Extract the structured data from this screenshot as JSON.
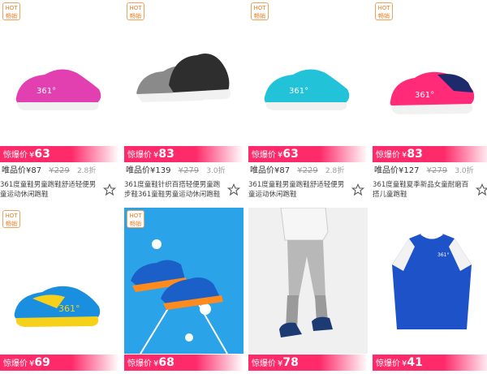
{
  "badge": {
    "line1": "HOT",
    "line2": "畅销"
  },
  "price_label": "惊爆价",
  "currency": "¥",
  "vip_label": "唯品价",
  "products": [
    {
      "price": "63",
      "vip_price": "87",
      "orig_price": "229",
      "discount": "2.8折",
      "title": "361度童鞋男童跑鞋舒适轻便男童运动休闲跑鞋",
      "image": "pink-sneaker",
      "bg": "#ffffff",
      "color": "#e23fb0"
    },
    {
      "price": "83",
      "vip_price": "139",
      "orig_price": "279",
      "discount": "3.0折",
      "title": "361度童鞋针织百搭轻便男童跑步鞋361童鞋男童运动休闲跑鞋",
      "image": "grey-knit-sneaker",
      "bg": "#ffffff",
      "color": "#8a8a8a"
    },
    {
      "price": "63",
      "vip_price": "87",
      "orig_price": "229",
      "discount": "2.8折",
      "title": "361度童鞋男童跑鞋舒适轻便男童运动休闲跑鞋",
      "image": "cyan-sneaker",
      "bg": "#ffffff",
      "color": "#22c2d8"
    },
    {
      "price": "83",
      "vip_price": "127",
      "orig_price": "279",
      "discount": "3.0折",
      "title": "361度童鞋夏季新品女童耐磨百搭儿童跑鞋",
      "image": "pink-navy-sneaker",
      "bg": "#ffffff",
      "color": "#ff2a78"
    },
    {
      "price": "69",
      "title": "",
      "image": "blue-yellow-sneaker",
      "bg": "#ffffff",
      "color": "#1a8fe0",
      "hot": true
    },
    {
      "price": "68",
      "title": "",
      "image": "blue-orange-sneakers-court",
      "bg": "#2aa3e8",
      "color": "#1a60c8",
      "hot": true
    },
    {
      "price": "78",
      "title": "",
      "image": "kid-grey-pants",
      "bg": "#f2f2f2",
      "color": "#aaaaaa"
    },
    {
      "price": "41",
      "title": "",
      "image": "blue-sport-shirt",
      "bg": "#ffffff",
      "color": "#1e52c8"
    }
  ]
}
